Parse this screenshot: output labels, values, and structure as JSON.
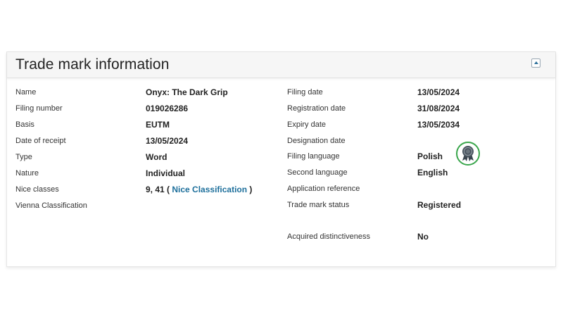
{
  "section": {
    "title": "Trade mark information"
  },
  "left_fields": [
    {
      "label": "Name",
      "value": "Onyx: The Dark Grip"
    },
    {
      "label": "Filing number",
      "value": "019026286"
    },
    {
      "label": "Basis",
      "value": "EUTM"
    },
    {
      "label": "Date of receipt",
      "value": "13/05/2024"
    },
    {
      "label": "Type",
      "value": "Word"
    },
    {
      "label": "Nature",
      "value": "Individual"
    },
    {
      "label": "Nice classes",
      "value_prefix": "9, 41 ( ",
      "link_text": "Nice Classification",
      "value_suffix": " )"
    },
    {
      "label": "Vienna Classification",
      "value": ""
    }
  ],
  "right_fields": [
    {
      "label": "Filing date",
      "value": "13/05/2024"
    },
    {
      "label": "Registration date",
      "value": "31/08/2024"
    },
    {
      "label": "Expiry date",
      "value": "13/05/2034"
    },
    {
      "label": "Designation date",
      "value": ""
    },
    {
      "label": "Filing language",
      "value": "Polish"
    },
    {
      "label": "Second language",
      "value": "English"
    },
    {
      "label": "Application reference",
      "value": ""
    },
    {
      "label": "Trade mark status",
      "value": "Registered",
      "icon": "registered-ribbon-icon"
    },
    {
      "label": "Acquired distinctiveness",
      "value": "No"
    }
  ],
  "colors": {
    "link": "#1d6f9b",
    "badge_ring": "#3aa64c",
    "badge_fill": "#3b4650"
  },
  "icons": {
    "collapse": "chevron-up-icon",
    "status": "registered-ribbon-icon"
  }
}
